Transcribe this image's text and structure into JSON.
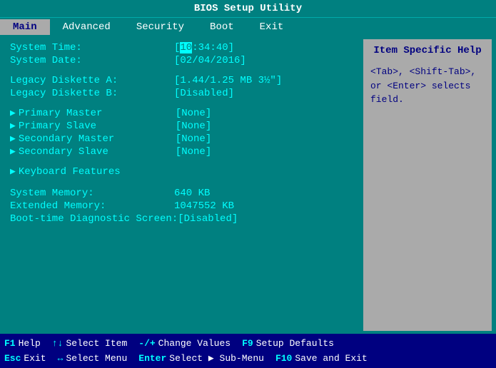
{
  "title": "BIOS Setup Utility",
  "menu": {
    "items": [
      {
        "label": "Main",
        "active": true
      },
      {
        "label": "Advanced",
        "active": false
      },
      {
        "label": "Security",
        "active": false
      },
      {
        "label": "Boot",
        "active": false
      },
      {
        "label": "Exit",
        "active": false
      }
    ]
  },
  "main": {
    "system_time_label": "System Time:",
    "system_time_value_cursor": "10",
    "system_time_value_rest": ":34:40]",
    "system_time_bracket_open": "[",
    "system_date_label": "System Date:",
    "system_date_value": "[02/04/2016]",
    "legacy_diskette_a_label": "Legacy Diskette A:",
    "legacy_diskette_a_value": "[1.44/1.25 MB  3½\"]",
    "legacy_diskette_b_label": "Legacy Diskette B:",
    "legacy_diskette_b_value": "[Disabled]",
    "primary_master_label": "Primary Master",
    "primary_master_value": "[None]",
    "primary_slave_label": "Primary Slave",
    "primary_slave_value": "[None]",
    "secondary_master_label": "Secondary Master",
    "secondary_master_value": "[None]",
    "secondary_slave_label": "Secondary Slave",
    "secondary_slave_value": "[None]",
    "keyboard_features_label": "Keyboard Features",
    "system_memory_label": "System Memory:",
    "system_memory_value": "640 KB",
    "extended_memory_label": "Extended Memory:",
    "extended_memory_value": "1047552 KB",
    "boot_diag_label": "Boot-time Diagnostic Screen:",
    "boot_diag_value": "[Disabled]"
  },
  "help": {
    "title": "Item Specific Help",
    "text": "<Tab>, <Shift-Tab>, or <Enter> selects field."
  },
  "bottom": {
    "row1": [
      {
        "key": "F1",
        "desc": "Help"
      },
      {
        "key": "↑↓",
        "desc": "Select Item"
      },
      {
        "key": "-/+",
        "desc": "Change Values"
      },
      {
        "key": "F9",
        "desc": "Setup Defaults"
      }
    ],
    "row2": [
      {
        "key": "Esc",
        "desc": "Exit"
      },
      {
        "key": "↔",
        "desc": "Select Menu"
      },
      {
        "key": "Enter",
        "desc": "Select ▶ Sub-Menu"
      },
      {
        "key": "F10",
        "desc": "Save and Exit"
      }
    ]
  }
}
